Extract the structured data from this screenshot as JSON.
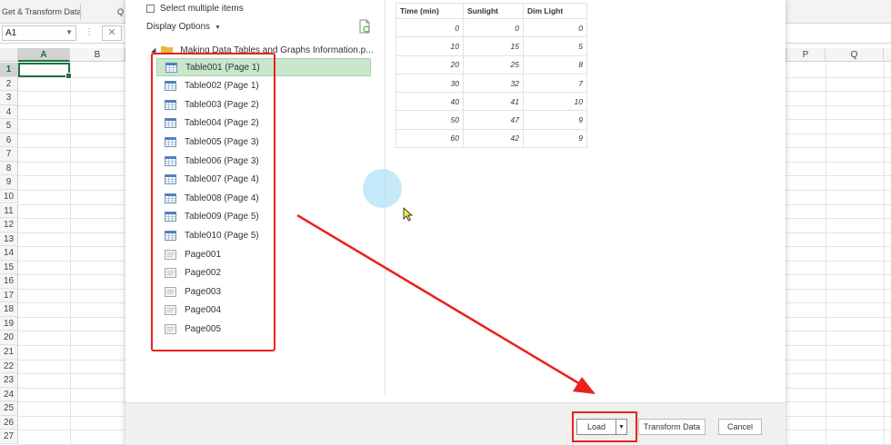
{
  "excel": {
    "ribbon": {
      "group_label": "Get & Transform Data",
      "next_group_initial": "Q"
    },
    "name_box": "A1",
    "columns_left": [
      "A",
      "B"
    ],
    "columns_right": [
      "P",
      "Q"
    ],
    "rows": [
      "1",
      "2",
      "3",
      "4",
      "5",
      "6",
      "7",
      "8",
      "9",
      "10",
      "11",
      "12",
      "13",
      "14",
      "15",
      "16",
      "17",
      "18",
      "19",
      "20",
      "21",
      "22",
      "23",
      "24",
      "25",
      "26",
      "27"
    ],
    "selected_cell": "A1"
  },
  "navigator": {
    "select_multiple_label": "Select multiple items",
    "select_multiple_checked": false,
    "display_options_label": "Display Options",
    "file_name": "Making Data Tables and Graphs Information.p...",
    "items": [
      {
        "label": "Table001 (Page 1)",
        "type": "table",
        "selected": true
      },
      {
        "label": "Table002 (Page 1)",
        "type": "table",
        "selected": false
      },
      {
        "label": "Table003 (Page 2)",
        "type": "table",
        "selected": false
      },
      {
        "label": "Table004 (Page 2)",
        "type": "table",
        "selected": false
      },
      {
        "label": "Table005 (Page 3)",
        "type": "table",
        "selected": false
      },
      {
        "label": "Table006 (Page 3)",
        "type": "table",
        "selected": false
      },
      {
        "label": "Table007 (Page 4)",
        "type": "table",
        "selected": false
      },
      {
        "label": "Table008 (Page 4)",
        "type": "table",
        "selected": false
      },
      {
        "label": "Table009 (Page 5)",
        "type": "table",
        "selected": false
      },
      {
        "label": "Table010 (Page 5)",
        "type": "table",
        "selected": false
      },
      {
        "label": "Page001",
        "type": "page",
        "selected": false
      },
      {
        "label": "Page002",
        "type": "page",
        "selected": false
      },
      {
        "label": "Page003",
        "type": "page",
        "selected": false
      },
      {
        "label": "Page004",
        "type": "page",
        "selected": false
      },
      {
        "label": "Page005",
        "type": "page",
        "selected": false
      }
    ]
  },
  "preview": {
    "headers": [
      "Time (min)",
      "Sunlight",
      "Dim Light"
    ],
    "rows": [
      [
        "0",
        "0",
        "0"
      ],
      [
        "10",
        "15",
        "5"
      ],
      [
        "20",
        "25",
        "8"
      ],
      [
        "30",
        "32",
        "7"
      ],
      [
        "40",
        "41",
        "10"
      ],
      [
        "50",
        "47",
        "9"
      ],
      [
        "60",
        "42",
        "9"
      ]
    ]
  },
  "footer": {
    "load_label": "Load",
    "transform_label": "Transform Data",
    "cancel_label": "Cancel"
  },
  "colors": {
    "selection_green": "#c8e7cc",
    "excel_green": "#217346",
    "annotation_red": "#e8231b",
    "folder_yellow": "#e8b93c",
    "table_icon_blue": "#4a7fc1"
  }
}
